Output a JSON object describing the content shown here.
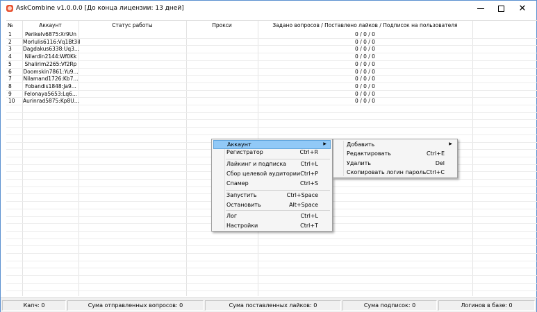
{
  "window": {
    "title": "AskCombine v1.0.0.0 [До конца лицензии: 13 дней]",
    "controls": {
      "minimize": "minimize-icon",
      "maximize": "maximize-icon",
      "close": "close-icon"
    }
  },
  "table": {
    "columns": [
      "№",
      "Аккаунт",
      "Статус работы",
      "Прокси",
      "Задано вопросов / Поставлено лайков / Подписок на пользователя"
    ],
    "rows": [
      {
        "num": "1",
        "account": "Perikelv6875:Xr9Un",
        "status": "",
        "proxy": "",
        "stats": "0 / 0 / 0"
      },
      {
        "num": "2",
        "account": "Morlulis6116:Vq1Bt3il",
        "status": "",
        "proxy": "",
        "stats": "0 / 0 / 0"
      },
      {
        "num": "3",
        "account": "Dagdakus6338:Uq3...",
        "status": "",
        "proxy": "",
        "stats": "0 / 0 / 0"
      },
      {
        "num": "4",
        "account": "Nilardin2144:Wf0Kk",
        "status": "",
        "proxy": "",
        "stats": "0 / 0 / 0"
      },
      {
        "num": "5",
        "account": "Shalirim2265:Vf2Rp",
        "status": "",
        "proxy": "",
        "stats": "0 / 0 / 0"
      },
      {
        "num": "6",
        "account": "Doomskin7861:Yu9...",
        "status": "",
        "proxy": "",
        "stats": "0 / 0 / 0"
      },
      {
        "num": "7",
        "account": "Nilamand1726:Kb7...",
        "status": "",
        "proxy": "",
        "stats": "0 / 0 / 0"
      },
      {
        "num": "8",
        "account": "Fobandis1848:Ja9...",
        "status": "",
        "proxy": "",
        "stats": "0 / 0 / 0"
      },
      {
        "num": "9",
        "account": "Felonaya5653:Lq6...",
        "status": "",
        "proxy": "",
        "stats": "0 / 0 / 0"
      },
      {
        "num": "10",
        "account": "Aurinrad5875:Kp8U...",
        "status": "",
        "proxy": "",
        "stats": "0 / 0 / 0"
      }
    ]
  },
  "context_menu": {
    "items": [
      {
        "label": "Аккаунт",
        "shortcut": "",
        "submenu": true,
        "highlighted": true
      },
      {
        "label": "Регистратор",
        "shortcut": "Ctrl+R"
      },
      {
        "label": "Лайкинг и подписка",
        "shortcut": "Ctrl+L"
      },
      {
        "label": "Сбор целевой аудитории",
        "shortcut": "Ctrl+P"
      },
      {
        "label": "Спамер",
        "shortcut": "Ctrl+S"
      },
      {
        "label": "Запустить",
        "shortcut": "Ctrl+Space"
      },
      {
        "label": "Остановить",
        "shortcut": "Alt+Space"
      },
      {
        "label": "Лог",
        "shortcut": "Ctrl+L"
      },
      {
        "label": "Настройки",
        "shortcut": "Ctrl+T"
      }
    ],
    "arrow_glyph": "▶"
  },
  "submenu": {
    "items": [
      {
        "label": "Добавить",
        "shortcut": "",
        "submenu": true
      },
      {
        "label": "Редактировать",
        "shortcut": "Ctrl+E"
      },
      {
        "label": "Удалить",
        "shortcut": "Del"
      },
      {
        "label": "Скопировать логин пароль",
        "shortcut": "Ctrl+C"
      }
    ],
    "arrow_glyph": "▶"
  },
  "statusbar": {
    "captcha": "Капч: 0",
    "questions_sent": "Сума отправленных вопросов: 0",
    "likes_sum": "Сума поставленных лайков: 0",
    "subscriptions_sum": "Сума подписок: 0",
    "logins_in_db": "Логинов в базе: 0"
  }
}
